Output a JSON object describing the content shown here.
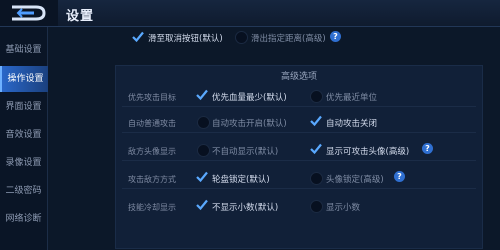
{
  "header": {
    "title": "设置"
  },
  "sidebar": {
    "items": [
      {
        "label": "基础设置",
        "active": false
      },
      {
        "label": "操作设置",
        "active": true
      },
      {
        "label": "界面设置",
        "active": false
      },
      {
        "label": "音效设置",
        "active": false
      },
      {
        "label": "录像设置",
        "active": false
      },
      {
        "label": "二级密码",
        "active": false
      },
      {
        "label": "网络诊断",
        "active": false
      }
    ]
  },
  "top_options": {
    "cancel_label": "滑至取消按钮(默认)",
    "distance_label": "滑出指定距离(高级)"
  },
  "advanced": {
    "title": "高级选项",
    "rows": [
      {
        "label": "优先攻击目标",
        "opt1": "优先血量最少(默认)",
        "opt2": "优先最近单位",
        "selected": 1
      },
      {
        "label": "自动普通攻击",
        "opt1": "自动攻击开启(默认)",
        "opt2": "自动攻击关闭",
        "selected": 2
      },
      {
        "label": "敌方头像显示",
        "opt1": "不自动显示(默认)",
        "opt2": "显示可攻击头像(高级)",
        "selected": 2
      },
      {
        "label": "攻击敌方方式",
        "opt1": "轮盘锁定(默认)",
        "opt2": "头像锁定(高级)",
        "selected": 1
      },
      {
        "label": "技能冷却显示",
        "opt1": "不显示小数(默认)",
        "opt2": "显示小数",
        "selected": 1
      }
    ]
  },
  "icons": {
    "logo": "back-arrow-logo-icon",
    "check": "checkmark-icon",
    "help": "question-icon"
  },
  "help_glyph": "?"
}
